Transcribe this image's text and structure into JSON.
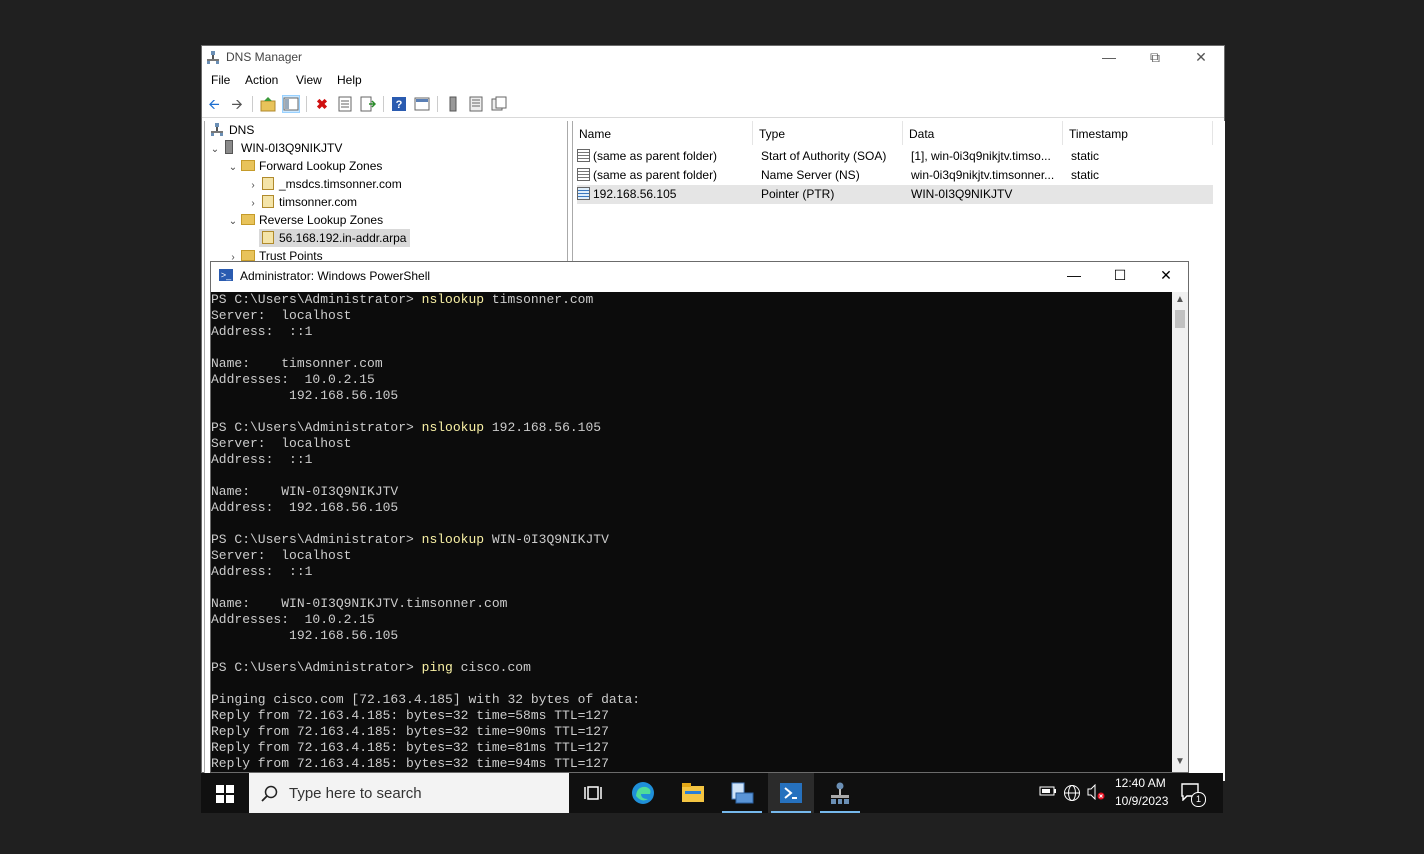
{
  "dns_window": {
    "title": "DNS Manager",
    "menu": [
      "File",
      "Action",
      "View",
      "Help"
    ],
    "tree": {
      "root": "DNS",
      "server": "WIN-0I3Q9NIKJTV",
      "forward_zones": "Forward Lookup Zones",
      "forward_children": [
        "_msdcs.timsonner.com",
        "timsonner.com"
      ],
      "reverse_zones": "Reverse Lookup Zones",
      "reverse_children": [
        "56.168.192.in-addr.arpa"
      ],
      "trust_points": "Trust Points"
    },
    "columns": [
      "Name",
      "Type",
      "Data",
      "Timestamp"
    ],
    "records": [
      {
        "name": "(same as parent folder)",
        "type": "Start of Authority (SOA)",
        "data": "[1], win-0i3q9nikjtv.timso...",
        "timestamp": "static"
      },
      {
        "name": "(same as parent folder)",
        "type": "Name Server (NS)",
        "data": "win-0i3q9nikjtv.timsonner...",
        "timestamp": "static"
      },
      {
        "name": "192.168.56.105",
        "type": "Pointer (PTR)",
        "data": "WIN-0I3Q9NIKJTV",
        "timestamp": ""
      }
    ]
  },
  "powershell_window": {
    "title": "Administrator: Windows PowerShell",
    "prompt": "PS C:\\Users\\Administrator> ",
    "lines": [
      {
        "prompt": "PS C:\\Users\\Administrator> ",
        "cmd": "nslookup",
        "arg": " timsonner.com"
      },
      {
        "text": "Server:  localhost"
      },
      {
        "text": "Address:  ::1"
      },
      {
        "text": ""
      },
      {
        "text": "Name:    timsonner.com"
      },
      {
        "text": "Addresses:  10.0.2.15"
      },
      {
        "text": "          192.168.56.105"
      },
      {
        "text": ""
      },
      {
        "prompt": "PS C:\\Users\\Administrator> ",
        "cmd": "nslookup",
        "arg": " 192.168.56.105"
      },
      {
        "text": "Server:  localhost"
      },
      {
        "text": "Address:  ::1"
      },
      {
        "text": ""
      },
      {
        "text": "Name:    WIN-0I3Q9NIKJTV"
      },
      {
        "text": "Address:  192.168.56.105"
      },
      {
        "text": ""
      },
      {
        "prompt": "PS C:\\Users\\Administrator> ",
        "cmd": "nslookup",
        "arg": " WIN-0I3Q9NIKJTV"
      },
      {
        "text": "Server:  localhost"
      },
      {
        "text": "Address:  ::1"
      },
      {
        "text": ""
      },
      {
        "text": "Name:    WIN-0I3Q9NIKJTV.timsonner.com"
      },
      {
        "text": "Addresses:  10.0.2.15"
      },
      {
        "text": "          192.168.56.105"
      },
      {
        "text": ""
      },
      {
        "prompt": "PS C:\\Users\\Administrator> ",
        "cmd": "ping",
        "arg": " cisco.com"
      },
      {
        "text": ""
      },
      {
        "text": "Pinging cisco.com [72.163.4.185] with 32 bytes of data:"
      },
      {
        "text": "Reply from 72.163.4.185: bytes=32 time=58ms TTL=127"
      },
      {
        "text": "Reply from 72.163.4.185: bytes=32 time=90ms TTL=127"
      },
      {
        "text": "Reply from 72.163.4.185: bytes=32 time=81ms TTL=127"
      },
      {
        "text": "Reply from 72.163.4.185: bytes=32 time=94ms TTL=127"
      }
    ]
  },
  "taskbar": {
    "search_placeholder": "Type here to search",
    "time": "12:40 AM",
    "date": "10/9/2023",
    "notification_count": "1",
    "apps": [
      "task-view-icon",
      "edge-icon",
      "file-explorer-icon",
      "server-manager-icon",
      "powershell-icon",
      "dns-manager-icon"
    ]
  },
  "colors": {
    "console_bg": "#0c0c0c",
    "console_text": "#cccccc",
    "command_text": "#f9f1a5",
    "selection": "#cce8ff",
    "taskbar": "#101010"
  }
}
